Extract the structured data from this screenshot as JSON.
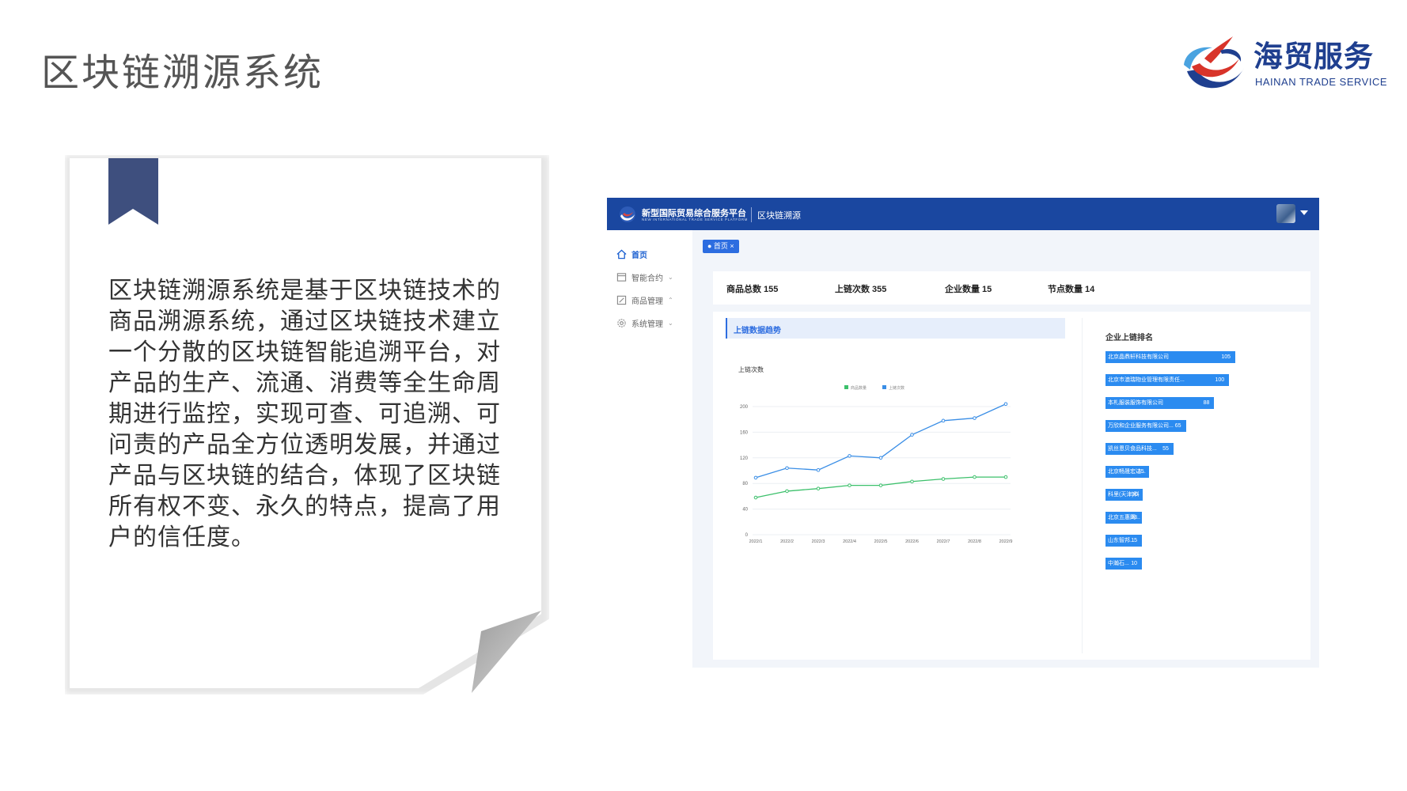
{
  "slide": {
    "title": "区块链溯源系统",
    "description": "区块链溯源系统是基于区块链技术的商品溯源系统，通过区块链技术建立一个分散的区块链智能追溯平台，对产品的生产、流通、消费等全生命周期进行监控，实现可查、可追溯、可问责的产品全方位透明发展，并通过产品与区块链的结合，体现了区块链所有权不变、永久的特点，提高了用户的信任度。"
  },
  "brand": {
    "name": "海贸服务",
    "subtitle": "HAINAN TRADE SERVICE",
    "colors": {
      "blue": "#1f3f8f",
      "red": "#d8342a",
      "light_blue": "#4aa3e0"
    }
  },
  "app": {
    "platform_name": "新型国际贸易综合服务平台",
    "platform_name_en": "NEW INTERNATIONAL TRADE SERVICE PLATFORM",
    "module": "区块链溯源",
    "header_color": "#1a47a0",
    "sidebar": {
      "items": [
        {
          "label": "首页",
          "icon": "home-icon",
          "active": true
        },
        {
          "label": "智能合约",
          "icon": "contract-icon",
          "chevron": "⌄"
        },
        {
          "label": "商品管理",
          "icon": "edit-icon",
          "chevron": "⌃"
        },
        {
          "label": "系统管理",
          "icon": "gear-icon",
          "chevron": "⌄"
        }
      ]
    },
    "tab": {
      "label": "● 首页 ×"
    },
    "stats": [
      {
        "label": "商品总数 155"
      },
      {
        "label": "上链次数 355"
      },
      {
        "label": "企业数量 15"
      },
      {
        "label": "节点数量 14"
      }
    ],
    "trend_title": "上链数据趋势",
    "ranking_title": "企业上链排名",
    "ranking": [
      {
        "name": "北京晶鼎轩科技有限公司",
        "value": 105
      },
      {
        "name": "北京市澳瑞物业管理有限责任...",
        "value": 100
      },
      {
        "name": "本札服装服饰有限公司",
        "value": 88
      },
      {
        "name": "万欣和企业服务有限公司...",
        "value": 65
      },
      {
        "name": "凯丝恩贝食品科技...",
        "value": 55
      },
      {
        "name": "北京畅晟宏达...",
        "value": 35
      },
      {
        "name": "科里(天津)科",
        "value": 30
      },
      {
        "name": "北京五惠网...",
        "value": 28
      },
      {
        "name": "山东智邦...",
        "value": 15
      },
      {
        "name": "中瀚石...",
        "value": 10
      }
    ]
  },
  "chart_data": {
    "type": "line",
    "title": "",
    "ylabel": "上链次数",
    "xlabel": "",
    "x": [
      "2022/1",
      "2022/2",
      "2022/3",
      "2022/4",
      "2022/5",
      "2022/6",
      "2022/7",
      "2022/8",
      "2022/9"
    ],
    "yticks": [
      0,
      40,
      80,
      120,
      160,
      200
    ],
    "ylim": [
      0,
      200
    ],
    "grid": true,
    "legend": "top-center",
    "series": [
      {
        "name": "商品数量",
        "color": "#3cc06b",
        "values": [
          58,
          68,
          72,
          77,
          77,
          83,
          87,
          90,
          90
        ]
      },
      {
        "name": "上链次数",
        "color": "#3a8ee6",
        "values": [
          89,
          104,
          101,
          123,
          120,
          156,
          178,
          182,
          204
        ]
      }
    ]
  }
}
